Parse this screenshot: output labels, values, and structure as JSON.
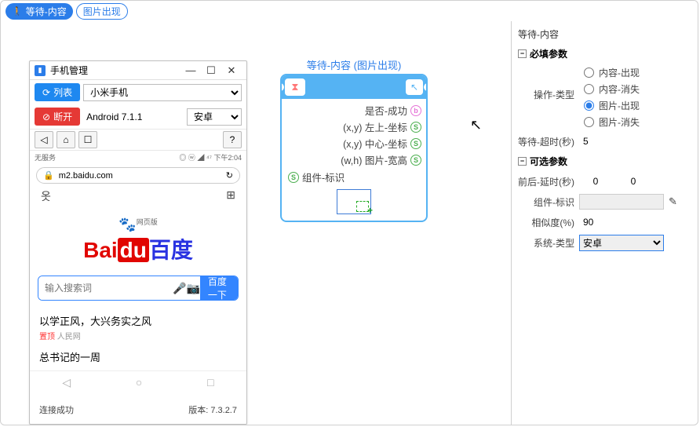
{
  "topbar": {
    "title": "等待-内容",
    "badge": "图片出现"
  },
  "phone_window": {
    "title": "手机管理",
    "btn_list": "列表",
    "btn_disconnect": "断开",
    "device_name": "小米手机",
    "os_version": "Android 7.1.1",
    "platform": "安卓",
    "status_left": "无服务",
    "status_right": "◎ ⓦ ◢ ⁴⁷ 下午2:04",
    "url": "m2.baidu.com",
    "logo_bai": "Bai",
    "logo_du": "du",
    "logo_cn": "百度",
    "logo_tag": "网页版",
    "search_placeholder": "输入搜索词",
    "search_btn": "百度一下",
    "news1": "以学正风，大兴务实之风",
    "news1_tag": "置顶",
    "news1_src": "人民网",
    "news2": "总书记的一周",
    "conn_status": "连接成功",
    "version_label": "版本: 7.3.2.7"
  },
  "node": {
    "title": "等待-内容 (图片出现)",
    "out1": "是否-成功",
    "out2": "(x,y) 左上-坐标",
    "out3": "(x,y) 中心-坐标",
    "out4": "(w,h) 图片-宽高",
    "in1": "组件-标识"
  },
  "props": {
    "panel_title": "等待-内容",
    "sec_required": "必填参数",
    "op_type_lbl": "操作-类型",
    "op1": "内容-出现",
    "op2": "内容-消失",
    "op3": "图片-出现",
    "op4": "图片-消失",
    "timeout_lbl": "等待-超时(秒)",
    "timeout_val": "5",
    "sec_optional": "可选参数",
    "delay_lbl": "前后-延时(秒)",
    "delay_a": "0",
    "delay_b": "0",
    "comp_id_lbl": "组件-标识",
    "sim_lbl": "相似度(%)",
    "sim_val": "90",
    "sys_lbl": "系统-类型",
    "sys_val": "安卓"
  }
}
